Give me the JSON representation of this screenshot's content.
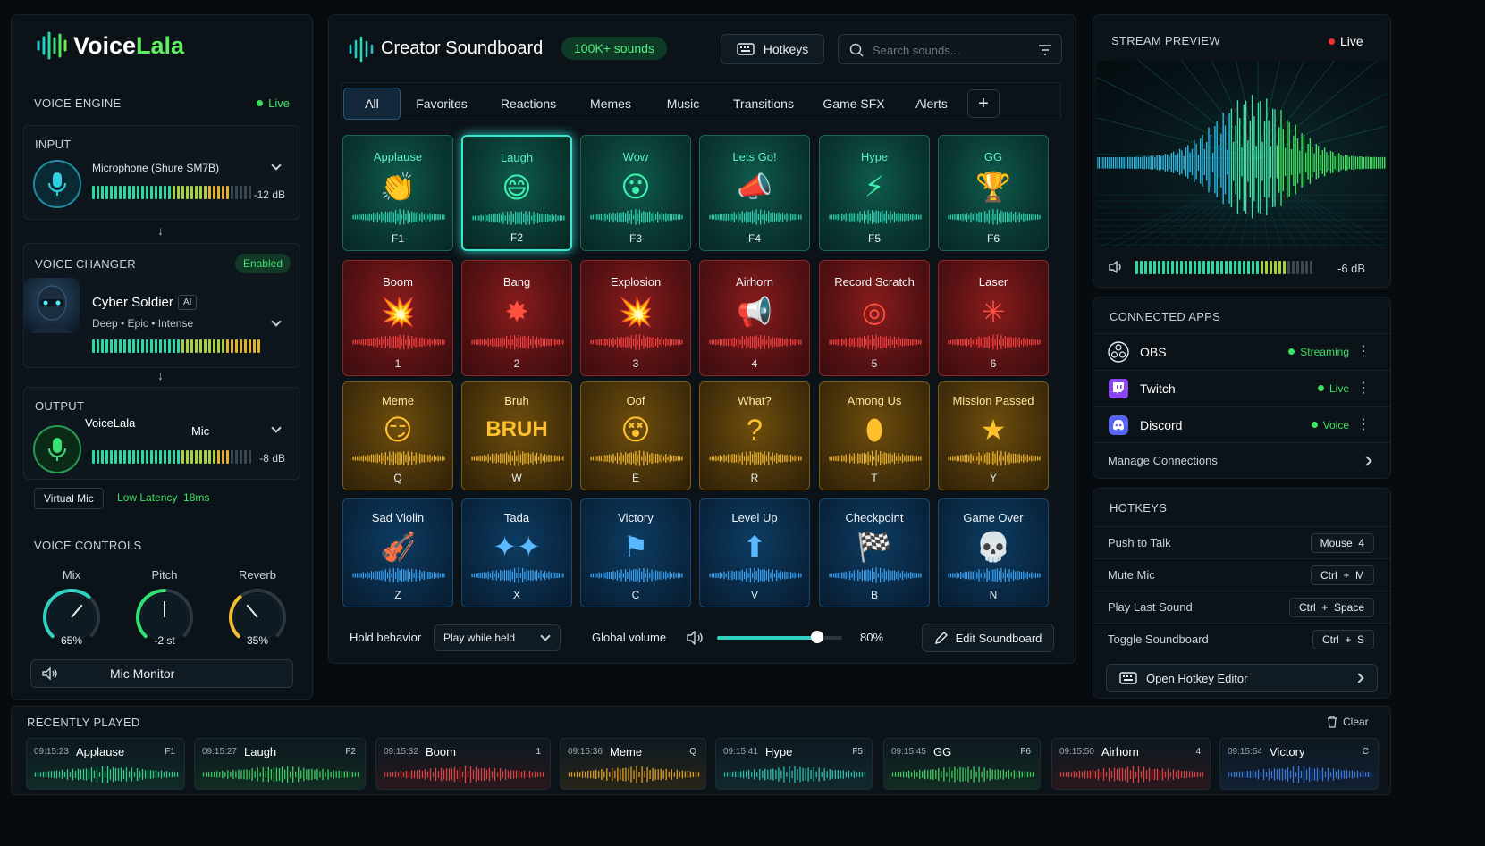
{
  "brand": {
    "voice": "Voice",
    "lala": "Lala"
  },
  "voice_engine": {
    "title": "VOICE ENGINE",
    "status": "Live"
  },
  "input": {
    "title": "INPUT",
    "device": "Microphone (Shure SM7B)",
    "level": "-12 dB"
  },
  "voice_changer": {
    "title": "VOICE CHANGER",
    "badge": "Enabled",
    "name": "Cyber Soldier",
    "ai": "AI",
    "tags": "Deep • Epic • Intense"
  },
  "output": {
    "title": "OUTPUT",
    "device": "VoiceLala",
    "mic": "Mic",
    "level": "-8 dB",
    "virtual": "Virtual Mic",
    "latency": "Low Latency  18ms"
  },
  "voice_controls": {
    "title": "VOICE CONTROLS",
    "knobs": [
      {
        "label": "Mix",
        "value": "65%",
        "level": 0.65,
        "color": "#2fd0c0"
      },
      {
        "label": "Pitch",
        "value": "-2 st",
        "level": 0.5,
        "color": "#30e070"
      },
      {
        "label": "Reverb",
        "value": "35%",
        "level": 0.35,
        "color": "#f0c030"
      }
    ],
    "monitor": "Mic Monitor"
  },
  "soundboard": {
    "title": "Creator Soundboard",
    "count": "100K+ sounds",
    "hotkeys": "Hotkeys",
    "search_placeholder": "Search sounds...",
    "tabs": [
      "All",
      "Favorites",
      "Reactions",
      "Memes",
      "Music",
      "Transitions",
      "Game SFX",
      "Alerts"
    ],
    "tiles": [
      {
        "label": "Applause",
        "key": "F1",
        "theme": "green",
        "icon": "clap-icon",
        "glyph": "👏"
      },
      {
        "label": "Laugh",
        "key": "F2",
        "theme": "green",
        "icon": "laugh-icon",
        "glyph": "😄",
        "selected": true
      },
      {
        "label": "Wow",
        "key": "F3",
        "theme": "green",
        "icon": "wow-icon",
        "glyph": "😮"
      },
      {
        "label": "Lets Go!",
        "key": "F4",
        "theme": "green",
        "icon": "megaphone-icon",
        "glyph": "📣"
      },
      {
        "label": "Hype",
        "key": "F5",
        "theme": "green",
        "icon": "lightning-icon",
        "glyph": "⚡"
      },
      {
        "label": "GG",
        "key": "F6",
        "theme": "green",
        "icon": "trophy-icon",
        "glyph": "🏆"
      },
      {
        "label": "Boom",
        "key": "1",
        "theme": "red",
        "icon": "boom-icon",
        "glyph": "💥"
      },
      {
        "label": "Bang",
        "key": "2",
        "theme": "red",
        "icon": "bang-icon",
        "glyph": "✸"
      },
      {
        "label": "Explosion",
        "key": "3",
        "theme": "red",
        "icon": "explosion-icon",
        "glyph": "💥"
      },
      {
        "label": "Airhorn",
        "key": "4",
        "theme": "red",
        "icon": "airhorn-icon",
        "glyph": "📢"
      },
      {
        "label": "Record Scratch",
        "key": "5",
        "theme": "red",
        "icon": "record-icon",
        "glyph": "◎"
      },
      {
        "label": "Laser",
        "key": "6",
        "theme": "red",
        "icon": "laser-icon",
        "glyph": "✳"
      },
      {
        "label": "Meme",
        "key": "Q",
        "theme": "yellow",
        "icon": "smirk-icon",
        "glyph": "😏"
      },
      {
        "label": "Bruh",
        "key": "W",
        "theme": "yellow",
        "icon": "bruh-icon",
        "glyph": "BRUH"
      },
      {
        "label": "Oof",
        "key": "E",
        "theme": "yellow",
        "icon": "oof-icon",
        "glyph": "😵"
      },
      {
        "label": "What?",
        "key": "R",
        "theme": "yellow",
        "icon": "question-icon",
        "glyph": "?"
      },
      {
        "label": "Among Us",
        "key": "T",
        "theme": "yellow",
        "icon": "crewmate-icon",
        "glyph": "⬮"
      },
      {
        "label": "Mission Passed",
        "key": "Y",
        "theme": "yellow",
        "icon": "star-icon",
        "glyph": "★"
      },
      {
        "label": "Sad Violin",
        "key": "Z",
        "theme": "blue",
        "icon": "violin-icon",
        "glyph": "🎻"
      },
      {
        "label": "Tada",
        "key": "X",
        "theme": "blue",
        "icon": "sparkle-icon",
        "glyph": "✦✦"
      },
      {
        "label": "Victory",
        "key": "C",
        "theme": "blue",
        "icon": "flag-icon",
        "glyph": "⚑"
      },
      {
        "label": "Level Up",
        "key": "V",
        "theme": "blue",
        "icon": "arrow-up-icon",
        "glyph": "⬆"
      },
      {
        "label": "Checkpoint",
        "key": "B",
        "theme": "blue",
        "icon": "checkered-flag-icon",
        "glyph": "🏁"
      },
      {
        "label": "Game Over",
        "key": "N",
        "theme": "blue",
        "icon": "skull-icon",
        "glyph": "💀"
      }
    ],
    "hold_label": "Hold behavior",
    "hold_value": "Play while held",
    "volume_label": "Global volume",
    "volume_value": "80%",
    "volume": 0.8,
    "edit": "Edit Soundboard"
  },
  "stream_preview": {
    "title": "STREAM PREVIEW",
    "status": "Live",
    "level": "-6 dB"
  },
  "connected_apps": {
    "title": "CONNECTED APPS",
    "apps": [
      {
        "name": "OBS",
        "status": "Streaming",
        "icon": "obs-icon"
      },
      {
        "name": "Twitch",
        "status": "Live",
        "icon": "twitch-icon"
      },
      {
        "name": "Discord",
        "status": "Voice",
        "icon": "discord-icon"
      }
    ],
    "manage": "Manage Connections"
  },
  "hotkeys": {
    "title": "HOTKEYS",
    "rows": [
      {
        "action": "Push to Talk",
        "keys": "Mouse  4"
      },
      {
        "action": "Mute Mic",
        "keys": "Ctrl  +  M"
      },
      {
        "action": "Play Last Sound",
        "keys": "Ctrl  +  Space"
      },
      {
        "action": "Toggle Soundboard",
        "keys": "Ctrl  +  S"
      }
    ],
    "open": "Open Hotkey Editor"
  },
  "recent": {
    "title": "RECENTLY PLAYED",
    "clear": "Clear",
    "items": [
      {
        "time": "09:15:23",
        "name": "Applause",
        "key": "F1",
        "color": "#2fd08a"
      },
      {
        "time": "09:15:27",
        "name": "Laugh",
        "key": "F2",
        "color": "#3ad060"
      },
      {
        "time": "09:15:32",
        "name": "Boom",
        "key": "1",
        "color": "#e04040"
      },
      {
        "time": "09:15:36",
        "name": "Meme",
        "key": "Q",
        "color": "#e0a020"
      },
      {
        "time": "09:15:41",
        "name": "Hype",
        "key": "F5",
        "color": "#2fc0b0"
      },
      {
        "time": "09:15:45",
        "name": "GG",
        "key": "F6",
        "color": "#40d060"
      },
      {
        "time": "09:15:50",
        "name": "Airhorn",
        "key": "4",
        "color": "#e04040"
      },
      {
        "time": "09:15:54",
        "name": "Victory",
        "key": "C",
        "color": "#3a7ae0"
      }
    ]
  }
}
